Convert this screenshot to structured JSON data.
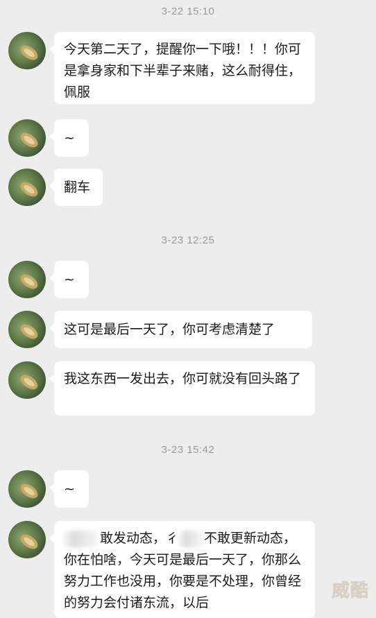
{
  "chat": {
    "timestamps": [
      "3-22 15:10",
      "3-23 12:25",
      "3-23 15:42"
    ],
    "messages": [
      {
        "text": "今天第二天了，提醒你一下哦！！！你可是拿身家和下半辈子来赌，这么耐得住，佩服"
      },
      {
        "text": "~"
      },
      {
        "text": "翻车"
      },
      {
        "text": "~"
      },
      {
        "text": "这可是最后一天了，你可考虑清楚了"
      },
      {
        "text": "我这东西一发出去，你可就没有回头路了"
      },
      {
        "text": "~"
      },
      {
        "part1": "敢发动态，",
        "part2": "不敢更新动态，你在怕啥，今天可是最后一天了，你那么努力工作也没用，你要是不处理，你曾经的努力会付诸东流，以后",
        "partial_char": "彳"
      }
    ]
  },
  "watermark": "威酷"
}
